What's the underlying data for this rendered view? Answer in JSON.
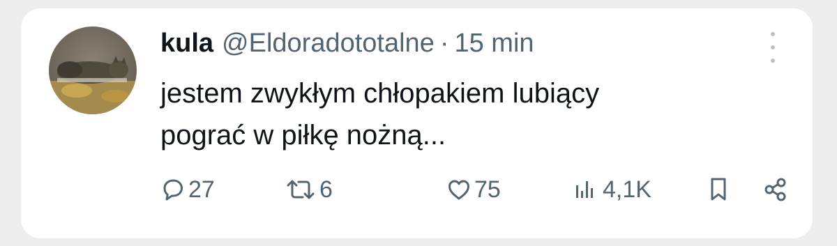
{
  "tweet": {
    "author_name": "kula",
    "author_handle": "@Eldoradototalne",
    "separator": "·",
    "time": "15 min",
    "text_lines": [
      "jestem zwykłym chłopakiem lubiący",
      "pograć w piłkę nożną..."
    ]
  },
  "actions": {
    "replies": "27",
    "retweets": "6",
    "likes": "75",
    "views": "4,1K"
  },
  "icons": {
    "reply": "reply-icon",
    "retweet": "retweet-icon",
    "like": "heart-icon",
    "views": "views-icon",
    "bookmark": "bookmark-icon",
    "share": "share-icon",
    "more": "more-vertical-icon"
  },
  "colors": {
    "text": "#0f1419",
    "secondary": "#536471",
    "card": "#ffffff",
    "background": "#ededed"
  }
}
